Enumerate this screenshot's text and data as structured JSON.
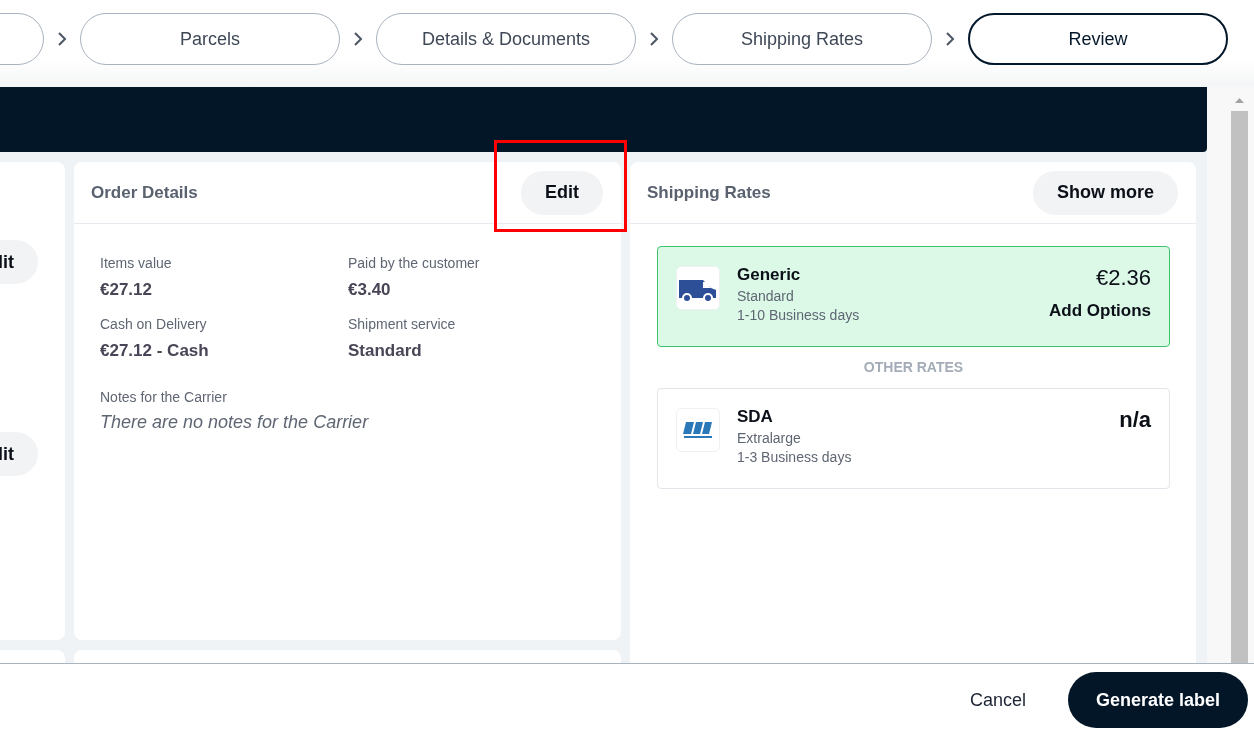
{
  "steps": [
    {
      "selected": false
    },
    {
      "label": "Parcels",
      "selected": false
    },
    {
      "label": "Details & Documents",
      "selected": false
    },
    {
      "label": "Shipping Rates",
      "selected": false
    },
    {
      "label": "Review",
      "selected": true
    }
  ],
  "left_column": {
    "edit_buttons": [
      "lit",
      "lit"
    ]
  },
  "order_details": {
    "title": "Order Details",
    "edit": "Edit",
    "fields": [
      {
        "label": "Items value",
        "value": "€27.12"
      },
      {
        "label": "Paid by the customer",
        "value": "€3.40"
      },
      {
        "label": "Cash on Delivery",
        "value": "€27.12 - Cash"
      },
      {
        "label": "Shipment service",
        "value": "Standard"
      }
    ],
    "notes_label": "Notes for the Carrier",
    "notes": "There are no notes for the Carrier"
  },
  "shipping_rates": {
    "title": "Shipping Rates",
    "show_more": "Show more",
    "rates": [
      {
        "kind": "van",
        "carrier": "Generic",
        "service": "Standard",
        "transit": "1-10 Business days",
        "price": "€2.36",
        "action": "Add Options",
        "selected": true
      },
      {
        "kind": "sda",
        "carrier": "SDA",
        "service": "Extralarge",
        "transit": "1-3 Business days",
        "price": "n/a",
        "selected": false
      }
    ],
    "other_label": "OTHER RATES"
  },
  "annotations": [
    {
      "kind": "rectangle"
    }
  ],
  "footer": {
    "cancel": "Cancel",
    "primary": "Generate label"
  }
}
